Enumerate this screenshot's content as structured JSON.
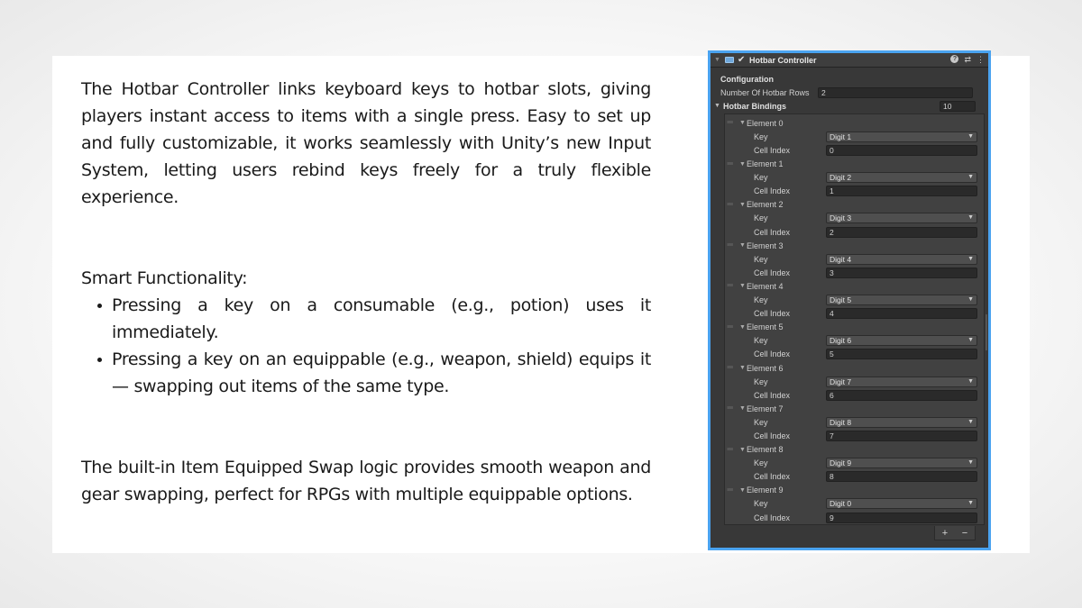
{
  "description": {
    "para1": "The Hotbar Controller links keyboard keys to hotbar slots, giving players instant access to items with a single press. Easy to set up and fully customizable, it works seamlessly with Unity’s new Input System, letting users rebind keys freely for a truly flexible experience.",
    "heading": "Smart Functionality:",
    "bullets": [
      "Pressing a key on a consumable (e.g., potion) uses it immediately.",
      "Pressing a key on an equippable (e.g., weapon, shield) equips it — swapping out items of the same type."
    ],
    "para3": "The built-in Item Equipped Swap logic provides smooth weapon and gear swapping, perfect for RPGs with multiple equippable options."
  },
  "inspector": {
    "component_title": "Hotbar Controller",
    "section_configuration": "Configuration",
    "rows_label": "Number Of Hotbar Rows",
    "rows_value": "2",
    "bindings_label": "Hotbar Bindings",
    "bindings_count": "10",
    "key_label": "Key",
    "cell_index_label": "Cell Index",
    "elements": [
      {
        "label": "Element 0",
        "key": "Digit 1",
        "cell_index": "0"
      },
      {
        "label": "Element 1",
        "key": "Digit 2",
        "cell_index": "1"
      },
      {
        "label": "Element 2",
        "key": "Digit 3",
        "cell_index": "2"
      },
      {
        "label": "Element 3",
        "key": "Digit 4",
        "cell_index": "3"
      },
      {
        "label": "Element 4",
        "key": "Digit 5",
        "cell_index": "4"
      },
      {
        "label": "Element 5",
        "key": "Digit 6",
        "cell_index": "5"
      },
      {
        "label": "Element 6",
        "key": "Digit 7",
        "cell_index": "6"
      },
      {
        "label": "Element 7",
        "key": "Digit 8",
        "cell_index": "7"
      },
      {
        "label": "Element 8",
        "key": "Digit 9",
        "cell_index": "8"
      },
      {
        "label": "Element 9",
        "key": "Digit 0",
        "cell_index": "9"
      }
    ],
    "add_label": "+",
    "remove_label": "−",
    "accent_color": "#4aa3f0"
  }
}
